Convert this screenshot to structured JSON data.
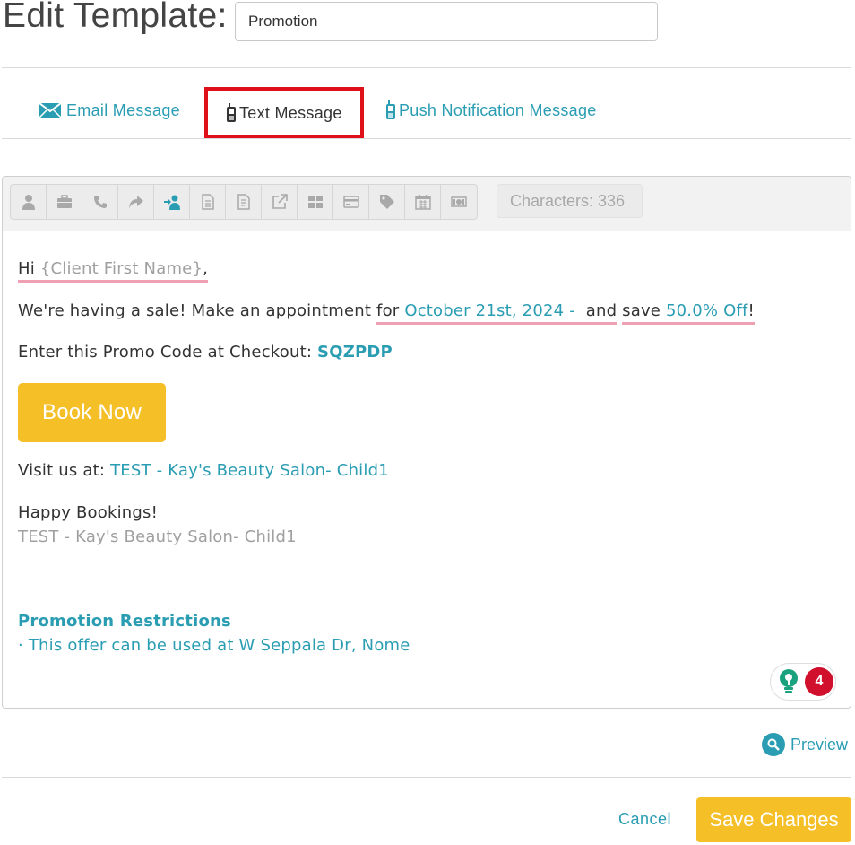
{
  "header": {
    "title": "Edit Template:",
    "template_name": "Promotion"
  },
  "tabs": [
    {
      "label": "Email Message",
      "icon": "envelope-icon",
      "active": false
    },
    {
      "label": "Text Message",
      "icon": "mobile-phone-icon",
      "active": true
    },
    {
      "label": "Push Notification Message",
      "icon": "mobile-phone-icon",
      "active": false
    }
  ],
  "toolbar": {
    "tools": [
      "user-icon",
      "briefcase-icon",
      "phone-icon",
      "share-arrow-icon",
      "sign-in-user-icon",
      "document-icon",
      "document-text-icon",
      "external-link-icon",
      "grid-icon",
      "credit-card-icon",
      "tag-icon",
      "calendar-icon",
      "money-icon"
    ],
    "characters": "Characters: 336"
  },
  "message": {
    "greeting_hi": "Hi",
    "client_first_name": "{Client First Name}",
    "greeting_comma": ",",
    "sale_text": "We're having a sale! Make an appointment",
    "for_word": "for",
    "date": "October 21st, 2024 -",
    "and_word": "and",
    "save_word": "save",
    "discount": "50.0% Off",
    "exclaim": "!",
    "promo_label": "Enter this Promo Code at Checkout:",
    "promo_code": "SQZPDP",
    "book_button": "Book Now",
    "visit_label": "Visit us at:",
    "salon_link": "TEST - Kay's Beauty Salon- Child1",
    "happy": "Happy Bookings!",
    "signature": "TEST - Kay's Beauty Salon- Child1",
    "restrictions_title": "Promotion Restrictions",
    "restriction_item": "· This offer can be used at W Seppala Dr, Nome"
  },
  "grammar_badge": {
    "count": "4"
  },
  "footer": {
    "preview": "Preview",
    "cancel": "Cancel",
    "save": "Save Changes"
  },
  "colors": {
    "accent": "#2a9db3",
    "button": "#f5bf27",
    "active_tab_outline": "#e0101a",
    "badge_red": "#d0102c"
  }
}
